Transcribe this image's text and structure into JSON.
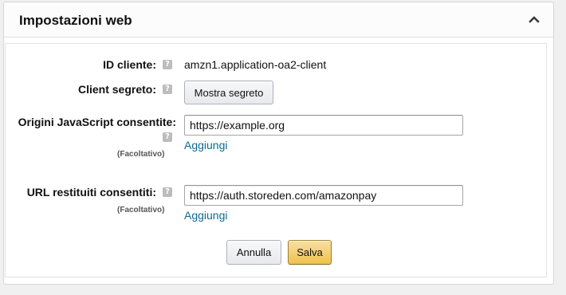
{
  "panel": {
    "title": "Impostazioni web",
    "collapse_icon": "chevron-up-icon"
  },
  "help_icon": {
    "glyph": "?",
    "name": "question-mark-icon"
  },
  "fields": {
    "client_id": {
      "label": "ID cliente:",
      "value": "amzn1.application-oa2-client"
    },
    "client_secret": {
      "label": "Client segreto:",
      "button_label": "Mostra segreto"
    },
    "js_origins": {
      "label": "Origini JavaScript consentite:",
      "optional": "(Facoltativo)",
      "value": "https://example.org",
      "add_link": "Aggiungi"
    },
    "return_urls": {
      "label": "URL restituiti consentiti:",
      "optional": "(Facoltativo)",
      "value": "https://auth.storeden.com/amazonpay",
      "add_link": "Aggiungi"
    }
  },
  "actions": {
    "cancel_label": "Annulla",
    "save_label": "Salva"
  },
  "colors": {
    "link": "#0e6a8f",
    "primary_button": "#f0c14b",
    "help_icon": "#bcbcbc"
  }
}
